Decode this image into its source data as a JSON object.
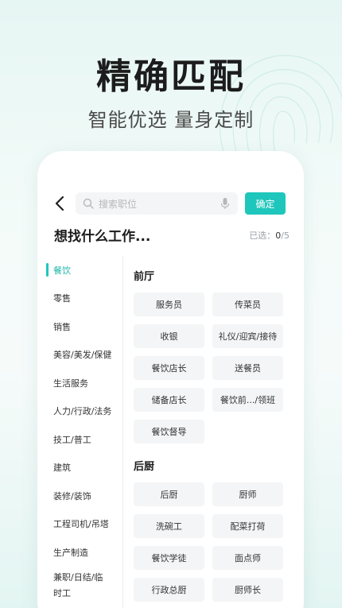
{
  "hero": {
    "title": "精确匹配",
    "subtitle": "智能优选 量身定制"
  },
  "search": {
    "placeholder": "搜索职位",
    "confirm_label": "确定"
  },
  "page": {
    "title": "想找什么工作...",
    "selected_label": "已选：",
    "selected_count": "0",
    "selected_total": "/5"
  },
  "sidebar": {
    "items": [
      {
        "label": "餐饮",
        "active": true
      },
      {
        "label": "零售"
      },
      {
        "label": "销售"
      },
      {
        "label": "美容/美发/保健"
      },
      {
        "label": "生活服务"
      },
      {
        "label": "人力/行政/法务"
      },
      {
        "label": "技工/普工"
      },
      {
        "label": "建筑"
      },
      {
        "label": "装修/装饰"
      },
      {
        "label": "工程司机/吊塔"
      },
      {
        "label": "生产制造"
      },
      {
        "label": "兼职/日结/临时工"
      }
    ]
  },
  "groups": [
    {
      "title": "前厅",
      "tags": [
        "服务员",
        "传菜员",
        "收银",
        "礼仪/迎宾/接待",
        "餐饮店长",
        "送餐员",
        "储备店长",
        "餐饮前.../领班",
        "餐饮督导"
      ]
    },
    {
      "title": "后厨",
      "tags": [
        "后厨",
        "厨师",
        "洗碗工",
        "配菜打荷",
        "餐饮学徒",
        "面点师",
        "行政总厨",
        "厨师长"
      ]
    }
  ],
  "colors": {
    "accent": "#1fc6bb"
  }
}
